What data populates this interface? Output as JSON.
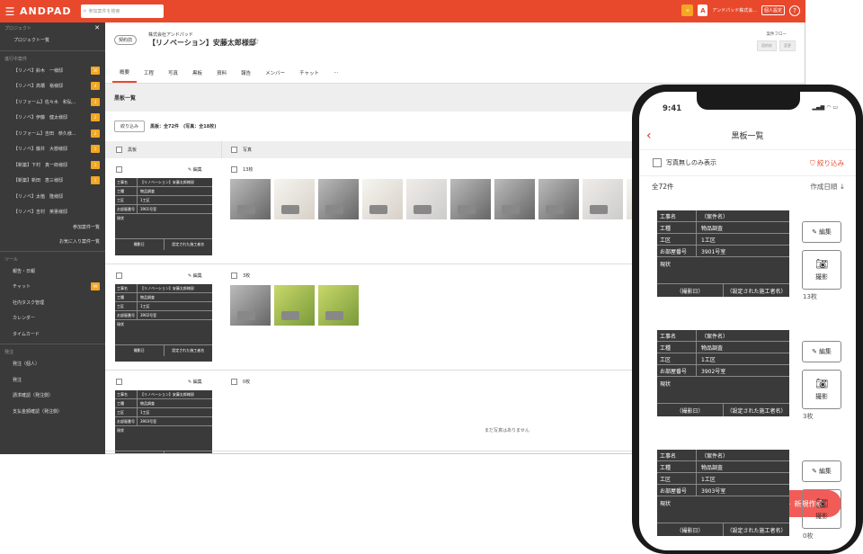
{
  "topbar": {
    "logo": "ANDPAD",
    "search_placeholder": "参加案件を検索",
    "company": "アンドパッド株式会...",
    "personal": "個人設定"
  },
  "sidebar": {
    "project_header": "プロジェクト",
    "project_list": "プロジェクト一覧",
    "active_header": "進行中案件",
    "items": [
      {
        "label": "【リノベ】鈴木　一様邸",
        "badge": "30"
      },
      {
        "label": "【リノベ】高橋　裕様邸",
        "badge": "4"
      },
      {
        "label": "【リフォーム】佐々木　和弘...",
        "badge": "3"
      },
      {
        "label": "【リノベ】伊藤　健太様邸",
        "badge": "2"
      },
      {
        "label": "【リフォーム】吉田　恭久様...",
        "badge": "2"
      },
      {
        "label": "【リノベ】藤井　大樹様邸",
        "badge": "1"
      },
      {
        "label": "【新築】下村　真一郎様邸",
        "badge": "1"
      },
      {
        "label": "【新築】新田　恵三様邸",
        "badge": "1"
      },
      {
        "label": "【リノベ】太植　隆様邸",
        "badge": ""
      },
      {
        "label": "【リノベ】吉村　英憲様邸",
        "badge": ""
      }
    ],
    "joined": "参加案件一覧",
    "favorites": "お気に入り案件一覧",
    "tools_header": "ツール",
    "tools": [
      {
        "label": "報告・日報",
        "badge": ""
      },
      {
        "label": "チャット",
        "badge": "99"
      },
      {
        "label": "社内タスク管理",
        "badge": ""
      },
      {
        "label": "カレンダー",
        "badge": ""
      },
      {
        "label": "タイムカード",
        "badge": ""
      }
    ],
    "order_header": "発注",
    "order": [
      {
        "label": "発注（個人）"
      },
      {
        "label": "発注"
      },
      {
        "label": "請求確認（発注側）"
      },
      {
        "label": "支払金額確認（発注側）"
      }
    ]
  },
  "page": {
    "status": "契約前",
    "company": "株式会社アンドパッド",
    "title": "【リノベーション】安藤太郎様邸",
    "flow_label": "案件フロー",
    "flow_value": "契約前",
    "flow_btn": "変更",
    "tabs": [
      "概要",
      "工程",
      "写真",
      "黒板",
      "資料",
      "報告",
      "メンバー",
      "チャット",
      "···"
    ],
    "section": "黒板一覧",
    "filter_btn": "絞り込み",
    "count": "黒板：全72件　(写真：全18枚)",
    "col_board": "黒板",
    "col_photo": "写真",
    "edit": "✎ 編集",
    "no_photo": "まだ写真はありません",
    "rows": [
      {
        "name": "【リノベーション】安藤太郎様邸",
        "type": "物品調査",
        "zone": "1工区",
        "room": "3901号室",
        "photos": "13枚",
        "p1": "撮影日",
        "p2": "設定された施工者名"
      },
      {
        "name": "【リノベーション】安藤太郎様邸",
        "type": "物品調査",
        "zone": "1工区",
        "room": "3902号室",
        "photos": "3枚",
        "p1": "撮影日",
        "p2": "設定された施工者名"
      },
      {
        "name": "【リノベーション】安藤太郎様邸",
        "type": "物品調査",
        "zone": "1工区",
        "room": "3903号室",
        "photos": "0枚",
        "p1": "撮影日",
        "p2": "設定された施工者名"
      }
    ],
    "labels": {
      "name": "工事名",
      "type": "工種",
      "zone": "工区",
      "room": "お部屋番号",
      "cur": "現状"
    }
  },
  "mobile": {
    "time": "9:41",
    "title": "黒板一覧",
    "filter_chk": "写真無しのみ表示",
    "filter": "絞り込み",
    "count": "全72件",
    "sort": "作成日順",
    "edit": "編集",
    "shoot": "撮影",
    "fab": "新規作成",
    "rows": [
      {
        "name": "（案件名）",
        "type": "物品調査",
        "zone": "1工区",
        "room": "3901号室",
        "photos": "13枚",
        "p1": "（撮影日）",
        "p2": "（設定された施工者名）"
      },
      {
        "name": "（案件名）",
        "type": "物品調査",
        "zone": "1工区",
        "room": "3902号室",
        "photos": "3枚",
        "p1": "（撮影日）",
        "p2": "（設定された施工者名）"
      },
      {
        "name": "（案件名）",
        "type": "物品調査",
        "zone": "1工区",
        "room": "3903号室",
        "photos": "0枚",
        "p1": "（撮影日）",
        "p2": "（設定された施工者名）"
      }
    ]
  }
}
